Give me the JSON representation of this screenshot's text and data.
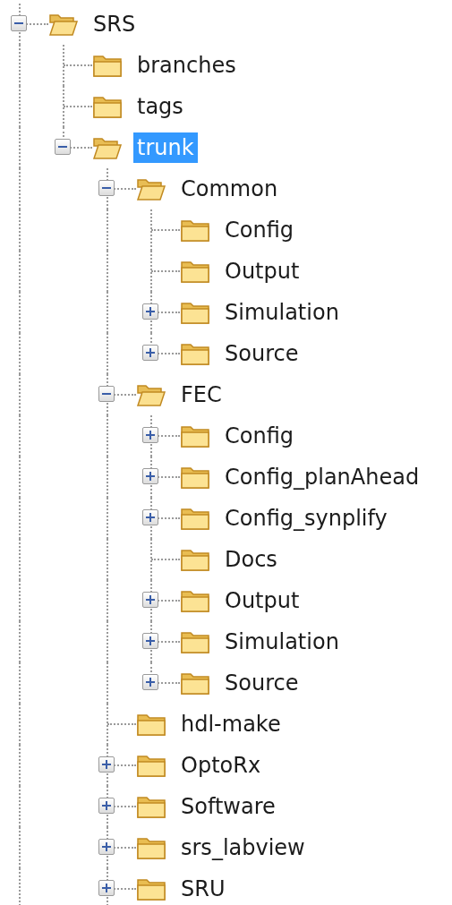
{
  "tree": [
    {
      "label": "SRS",
      "selected": false,
      "expanded": true,
      "continues": true,
      "children": [
        {
          "label": "branches",
          "selected": false
        },
        {
          "label": "tags",
          "selected": false
        },
        {
          "label": "trunk",
          "selected": true,
          "expanded": true,
          "children": [
            {
              "label": "Common",
              "selected": false,
              "expanded": true,
              "children": [
                {
                  "label": "Config",
                  "selected": false
                },
                {
                  "label": "Output",
                  "selected": false
                },
                {
                  "label": "Simulation",
                  "selected": false,
                  "expanded": false
                },
                {
                  "label": "Source",
                  "selected": false,
                  "expanded": false
                }
              ]
            },
            {
              "label": "FEC",
              "selected": false,
              "expanded": true,
              "children": [
                {
                  "label": "Config",
                  "selected": false,
                  "expanded": false
                },
                {
                  "label": "Config_planAhead",
                  "selected": false,
                  "expanded": false
                },
                {
                  "label": "Config_synplify",
                  "selected": false,
                  "expanded": false
                },
                {
                  "label": "Docs",
                  "selected": false
                },
                {
                  "label": "Output",
                  "selected": false,
                  "expanded": false
                },
                {
                  "label": "Simulation",
                  "selected": false,
                  "expanded": false
                },
                {
                  "label": "Source",
                  "selected": false,
                  "expanded": false
                }
              ]
            },
            {
              "label": "hdl-make",
              "selected": false
            },
            {
              "label": "OptoRx",
              "selected": false,
              "expanded": false
            },
            {
              "label": "Software",
              "selected": false,
              "expanded": false
            },
            {
              "label": "srs_labview",
              "selected": false,
              "expanded": false
            },
            {
              "label": "SRU",
              "selected": false,
              "expanded": false,
              "continues": true
            }
          ]
        }
      ]
    }
  ]
}
